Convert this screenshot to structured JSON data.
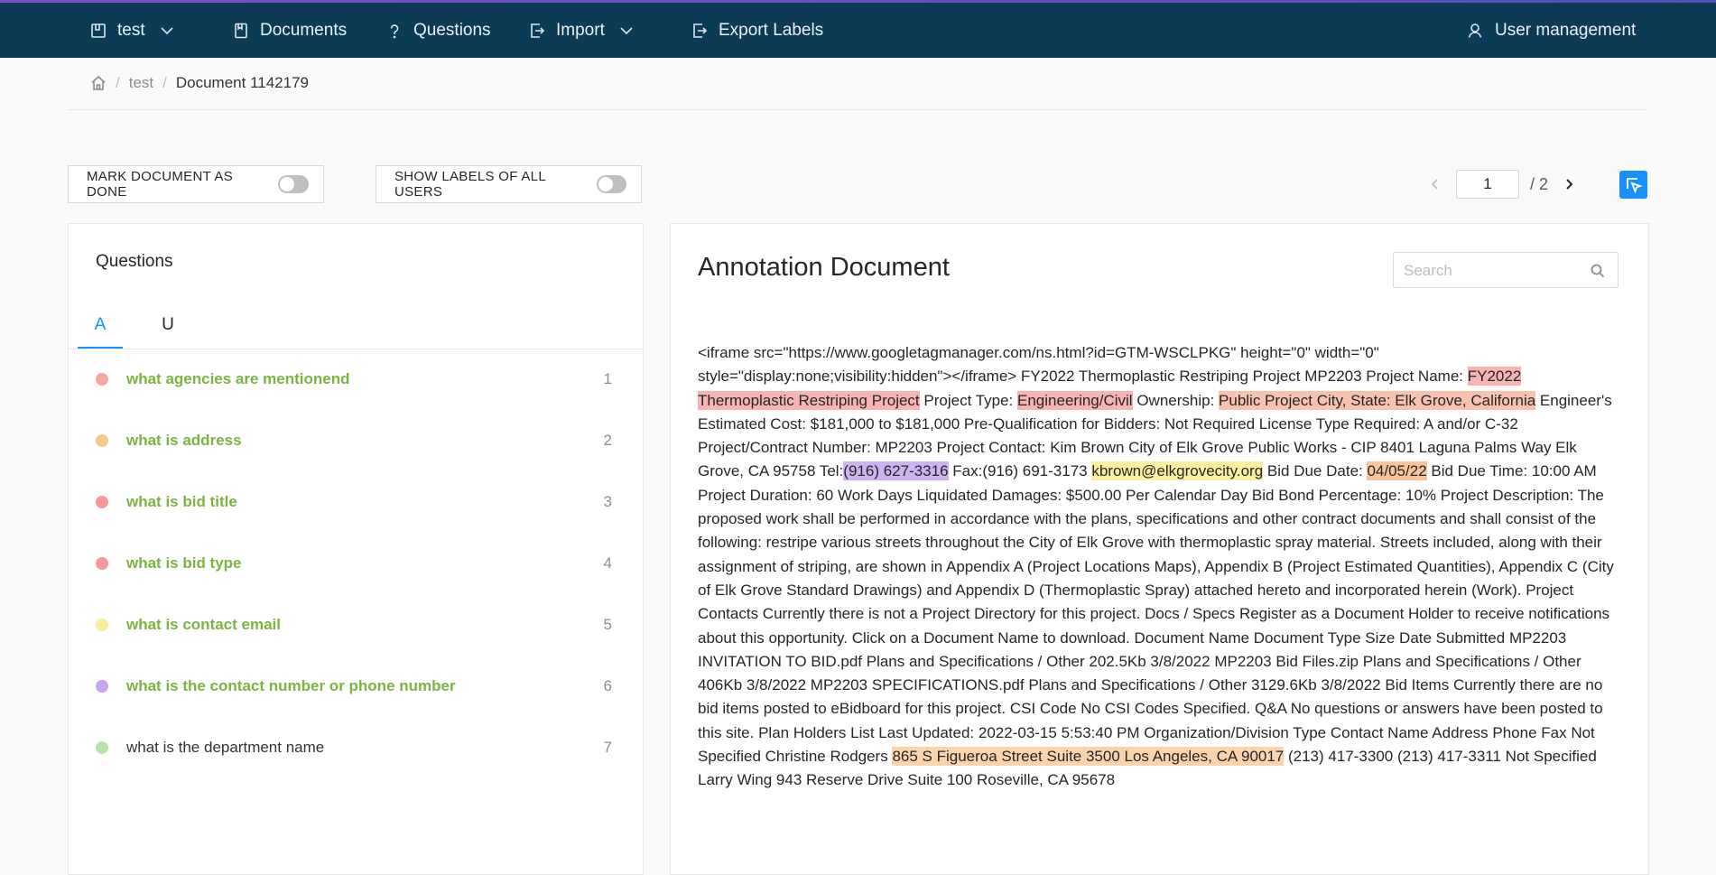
{
  "nav": {
    "project": "test",
    "documents": "Documents",
    "questions": "Questions",
    "import": "Import",
    "export": "Export Labels",
    "user_management": "User management"
  },
  "breadcrumb": {
    "project": "test",
    "document": "Document 1142179"
  },
  "controls": {
    "mark_done": "MARK DOCUMENT AS DONE",
    "show_labels": "SHOW LABELS OF ALL USERS"
  },
  "pager": {
    "current": "1",
    "total": "/ 2"
  },
  "questions_panel": {
    "title": "Questions",
    "tabs": [
      "A",
      "U"
    ],
    "items": [
      {
        "text": "what agencies are mentionend",
        "num": "1",
        "color": "#f4a8a0",
        "style": "bold"
      },
      {
        "text": "what is address",
        "num": "2",
        "color": "#f8c98e",
        "style": "bold"
      },
      {
        "text": "what is bid title",
        "num": "3",
        "color": "#f49a9a",
        "style": "bold"
      },
      {
        "text": "what is bid type",
        "num": "4",
        "color": "#f49a9a",
        "style": "bold"
      },
      {
        "text": "what is contact email",
        "num": "5",
        "color": "#f7ec9a",
        "style": "bold"
      },
      {
        "text": "what is the contact number or phone number",
        "num": "6",
        "color": "#c7a6ef",
        "style": "bold"
      },
      {
        "text": "what is the department name",
        "num": "7",
        "color": "#b9e3a9",
        "style": "plain"
      }
    ]
  },
  "document_panel": {
    "title": "Annotation Document",
    "search_placeholder": "Search",
    "segments": [
      {
        "t": " <iframe src=\"https://www.googletagmanager.com/ns.html?id=GTM-WSCLPKG\"     height=\"0\" width=\"0\" style=\"display:none;visibility:hidden\"></iframe>                          FY2022 Thermoplastic Restriping Project     MP2203     Project Name: "
      },
      {
        "t": "FY2022 Thermoplastic Restriping Project",
        "hl": "#f8b4b4"
      },
      {
        "t": "  Project Type:  "
      },
      {
        "t": "Engineering/Civil",
        "hl": "#f8b4b4"
      },
      {
        "t": "  Ownership: "
      },
      {
        "t": "Public   Project City, State:  Elk Grove, California",
        "hl": "#f9c2b0"
      },
      {
        "t": "  Engineer's Estimated Cost:  $181,000 to $181,000   Pre-Qualification for Bidders: Not Required  License Type Required: A and/or C-32  Project/Contract Number: MP2203  Project Contact:               Kim Brown               City of Elk Grove Public Works - CIP                  8401 Laguna Palms Way                 Elk Grove, CA 95758                Tel:"
      },
      {
        "t": "(916) 627-3316",
        "hl": "#cdb4f0"
      },
      {
        "t": "     Fax:(916) 691-3173               "
      },
      {
        "t": "kbrown@elkgrovecity.org",
        "hl": "#f9ef9e"
      },
      {
        "t": "  Bid Due Date:  "
      },
      {
        "t": "04/05/22",
        "hl": "#f8c49c"
      },
      {
        "t": "   Bid Due Time:  10:00 AM   Project Duration:  60 Work Days                Liquidated Damages:  $500.00 Per Calendar Day   Bid Bond Percentage:  10%    Project Description: The proposed work shall be performed in accordance with the plans, specifications and other contract documents and shall consist of the following: restripe various streets throughout the City of Elk Grove with thermoplastic spray material. Streets included, along with their assignment of striping, are shown in Appendix A (Project Locations Maps), Appendix B (Project Estimated Quantities),               Appendix C (City of Elk Grove Standard Drawings) and Appendix D (Thermoplastic Spray) attached hereto and incorporated herein               (Work).                       Project Contacts        Currently there is not a Project Directory for this project.                         Docs / Specs    Register as a Document Holder to receive notifications about this opportunity.    Click on a                      Document Name to download.                        Document Name   Document Type   Size   Date Submitted                     MP2203 INVITATION TO BID.pdf Plans and Specifications / Other 202.5Kb 3/8/2022                         MP2203 Bid Files.zip Plans and Specifications / Other 406Kb 3/8/2022                         MP2203 SPECIFICATIONS.pdf Plans and Specifications / Other 3129.6Kb 3/8/2022              Bid Items      Currently there are no bid items posted to eBidboard for this project.                  CSI Code    No CSI Codes Specified.        Q&A   No questions or answers have been posted to this site.     Plan Holders  List Last Updated: 2022-03-15 5:53:40 PM     Organization/Division Type        Contact Name  Address          Phone Fax                Not Specified        Christine Rodgers  "
      },
      {
        "t": "865 S Figueroa Street Suite 3500          Los Angeles, CA 90017",
        "hl": "#fbd3ad"
      },
      {
        "t": "        (213) 417-3300  (213) 417-3311          Not Specified        Larry Wing  943 Reserve Drive Suite 100          Roseville, CA 95678"
      }
    ]
  }
}
